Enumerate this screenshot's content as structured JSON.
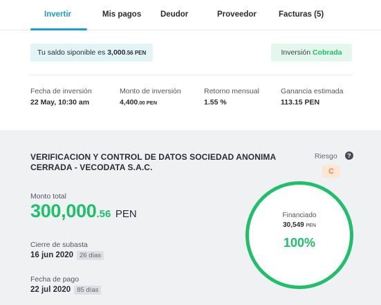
{
  "tabs": [
    {
      "label": "Invertir",
      "active": true
    },
    {
      "label": "Mis pagos"
    },
    {
      "label": "Deudor"
    },
    {
      "label": "Proveedor"
    },
    {
      "label": "Facturas (5)"
    }
  ],
  "saldo": {
    "prefix": "Tu saldo siponible es",
    "amount_int": "3,000",
    "amount_dec": ".56 PEN"
  },
  "inversion": {
    "label": "Inversión",
    "status": "Cobrada"
  },
  "stats": [
    {
      "label": "Fecha de inversión",
      "value": "22 May, 10:30 am",
      "suffix": ""
    },
    {
      "label": "Monto de inversión",
      "value": "4,400",
      "suffix": ".00 PEN"
    },
    {
      "label": "Retorno mensual",
      "value": "1.55 %",
      "suffix": ""
    },
    {
      "label": "Ganancia estimada",
      "value": "113.15 PEN",
      "suffix": ""
    }
  ],
  "company": {
    "name": "VERIFICACION Y CONTROL DE DATOS SOCIEDAD ANONIMA CERRADA - VECODATA S.A.C.",
    "risk_label": "Riesgo",
    "risk_value": "C",
    "help_icon": "question-icon"
  },
  "monto_total": {
    "label": "Monto total",
    "int": "300,000",
    "dec": ".56",
    "currency": "PEN"
  },
  "cierre": {
    "label": "Cierre de subasta",
    "date": "16 jun 2020",
    "days": "26 días"
  },
  "pago": {
    "label": "Fecha de pago",
    "date": "22 jul 2020",
    "days": "85 días"
  },
  "financiado": {
    "label": "Financiado",
    "amount": "30,549",
    "currency": "PEN",
    "percent_text": "100%",
    "percent": 100
  },
  "colors": {
    "accent": "#1e9bd7",
    "green": "#1fbf6b",
    "risk_orange": "#f08a38",
    "card_bg": "#f0f1f3"
  }
}
